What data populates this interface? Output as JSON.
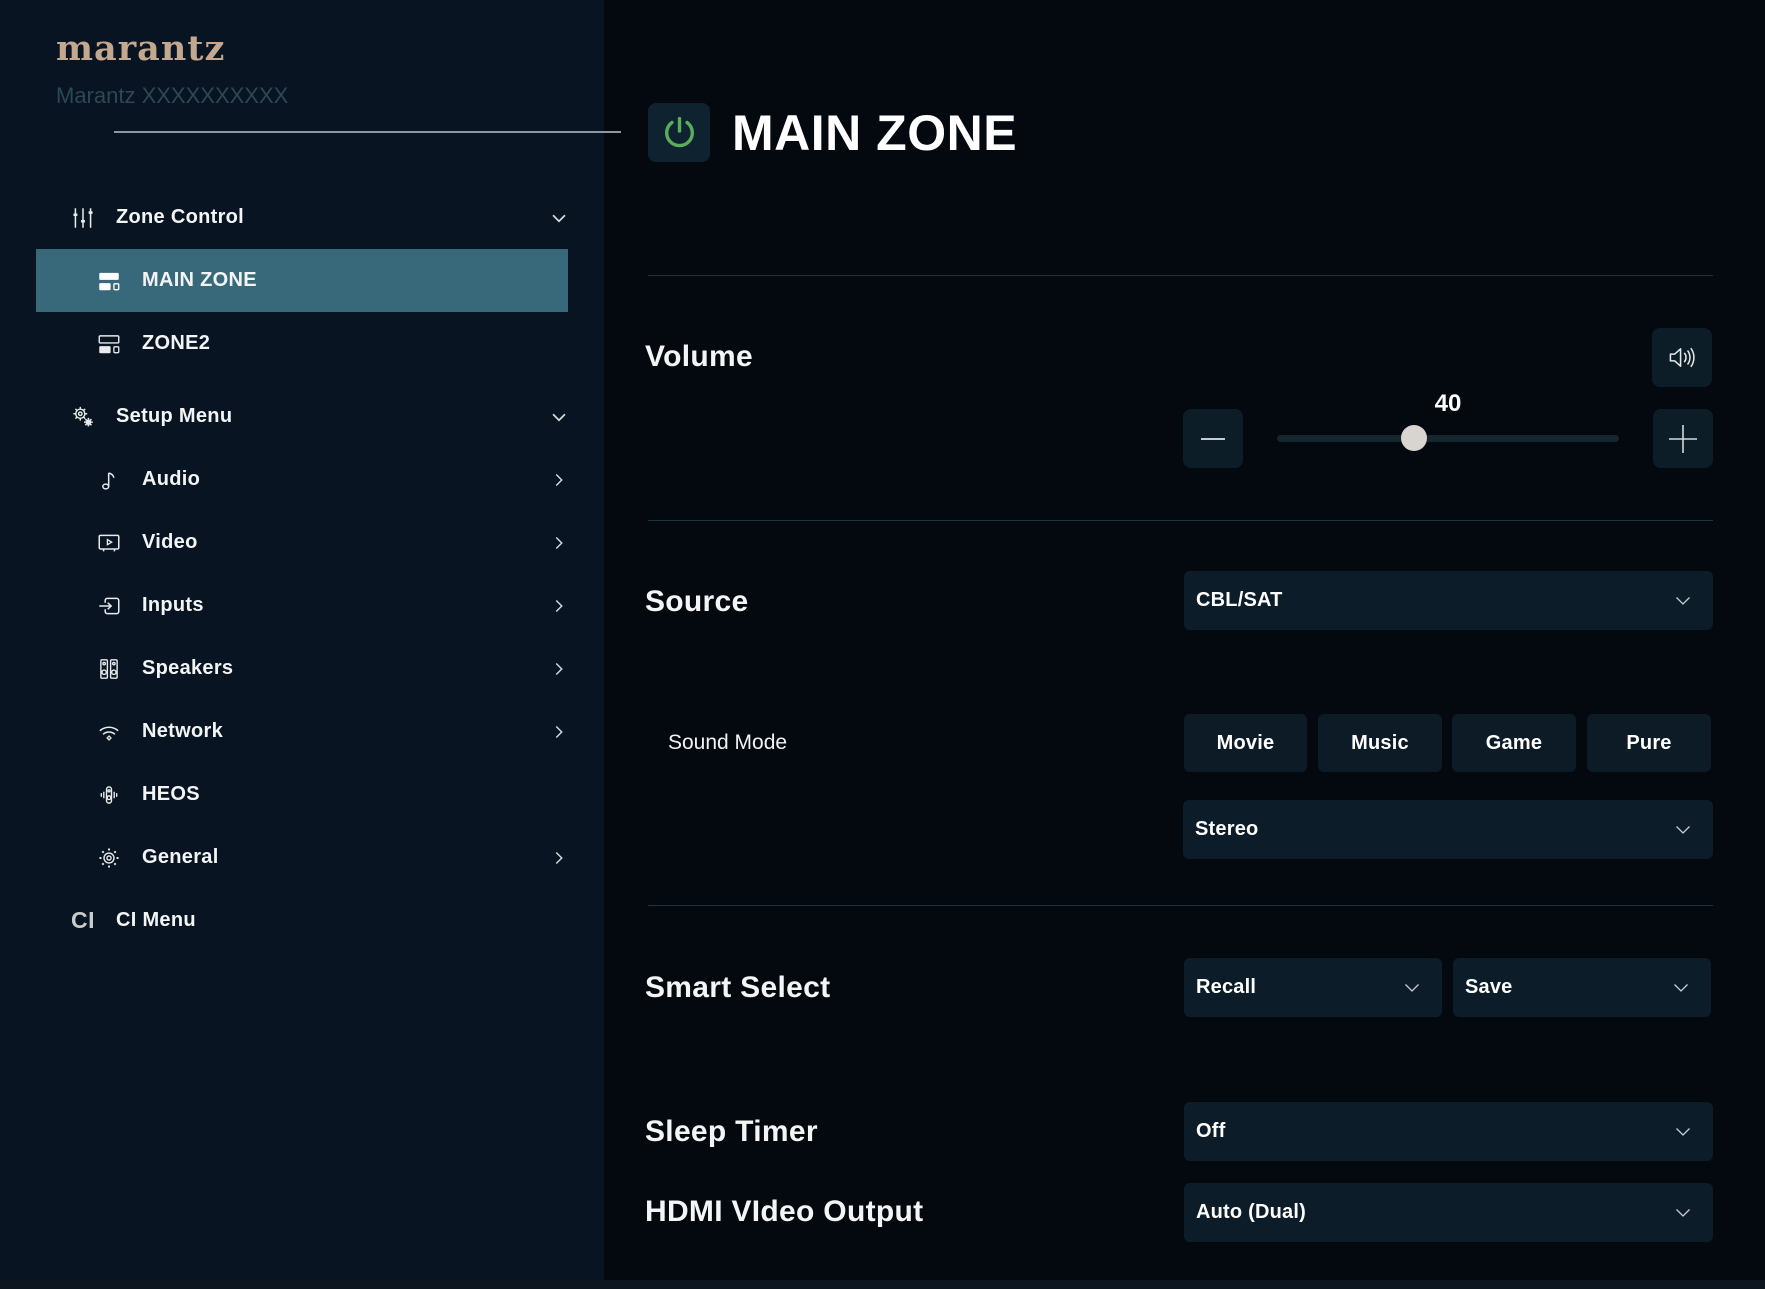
{
  "sidebar": {
    "logo": "marantz",
    "device_name": "Marantz XXXXXXXXXX",
    "groups": [
      {
        "label": "Zone Control",
        "icon": "sliders-icon",
        "expanded": true,
        "children": [
          {
            "label": "MAIN ZONE",
            "icon": "zones-icon",
            "active": true
          },
          {
            "label": "ZONE2",
            "icon": "zones-alt-icon",
            "active": false
          }
        ]
      },
      {
        "label": "Setup Menu",
        "icon": "gears-icon",
        "expanded": true,
        "children": [
          {
            "label": "Audio",
            "icon": "music-note-icon",
            "chevron": "right"
          },
          {
            "label": "Video",
            "icon": "tv-icon",
            "chevron": "right"
          },
          {
            "label": "Inputs",
            "icon": "input-icon",
            "chevron": "right"
          },
          {
            "label": "Speakers",
            "icon": "speakers-icon",
            "chevron": "right"
          },
          {
            "label": "Network",
            "icon": "wifi-icon",
            "chevron": "right"
          },
          {
            "label": "HEOS",
            "icon": "heos-icon"
          },
          {
            "label": "General",
            "icon": "gear-icon",
            "chevron": "right"
          }
        ]
      }
    ],
    "ci_menu": {
      "icon_text": "CI",
      "label": "CI Menu"
    }
  },
  "main": {
    "zone_title": "MAIN ZONE",
    "power_state": "on",
    "volume": {
      "label": "Volume",
      "value": 40,
      "min": 0,
      "max": 100
    },
    "source": {
      "label": "Source",
      "selected": "CBL/SAT"
    },
    "sound_mode": {
      "label": "Sound Mode",
      "modes": [
        "Movie",
        "Music",
        "Game",
        "Pure"
      ],
      "selected": "Stereo"
    },
    "smart_select": {
      "label": "Smart Select",
      "recall": "Recall",
      "save": "Save"
    },
    "sleep_timer": {
      "label": "Sleep Timer",
      "selected": "Off"
    },
    "hdmi_video_output": {
      "label": "HDMI VIdeo Output",
      "selected": "Auto (Dual)"
    }
  },
  "colors": {
    "sidebar_bg": "#081421",
    "main_bg": "#04090F",
    "active_item_teal": "#38697A",
    "panel": "#0C1C28",
    "power_green": "#5BAD5A",
    "logo_tan": "#C3A78F",
    "divider": "#1C3440",
    "slider_thumb": "#D8D5D1"
  }
}
